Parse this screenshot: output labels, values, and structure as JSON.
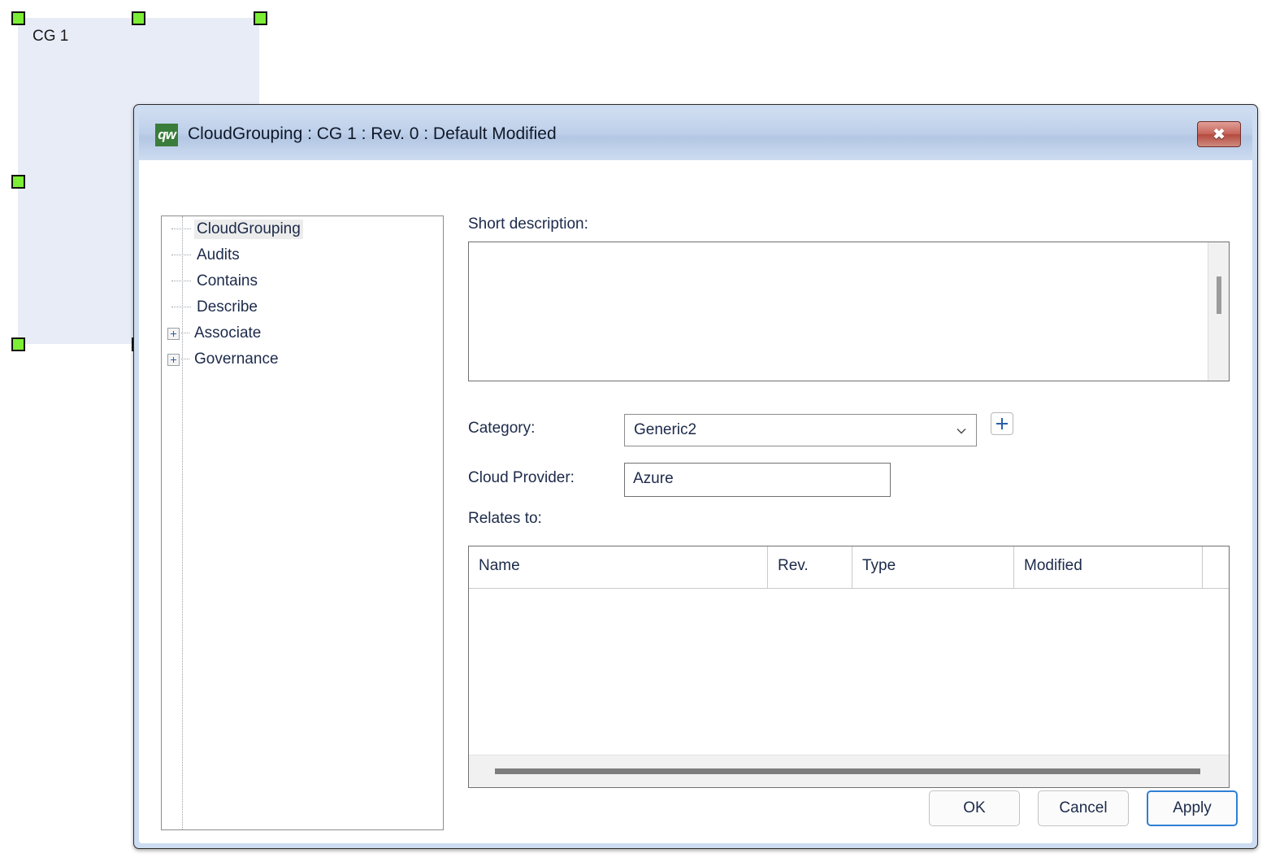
{
  "canvas": {
    "shape": {
      "label": "CG 1",
      "fill_color": "#e8ecf6",
      "handle_color": "#7cee35"
    },
    "handles": [
      {
        "name": "handle-top-left"
      },
      {
        "name": "handle-top-center"
      },
      {
        "name": "handle-top-right"
      },
      {
        "name": "handle-middle-left"
      },
      {
        "name": "handle-bottom-left"
      },
      {
        "name": "handle-bottom-center"
      }
    ]
  },
  "dialog": {
    "title": "CloudGrouping : CG 1 : Rev. 0 : Default Modified",
    "app_icon_text": "qw",
    "close_glyph": "✖",
    "accent_color": "#2f7fd6",
    "titlebar_color": "#bed0ea",
    "tree": {
      "items": [
        {
          "label": "CloudGrouping",
          "expandable": false,
          "selected": true
        },
        {
          "label": "Audits",
          "expandable": false,
          "selected": false
        },
        {
          "label": "Contains",
          "expandable": false,
          "selected": false
        },
        {
          "label": "Describe",
          "expandable": false,
          "selected": false
        },
        {
          "label": "Associate",
          "expandable": true,
          "selected": false
        },
        {
          "label": "Governance",
          "expandable": true,
          "selected": false
        }
      ]
    },
    "form": {
      "short_description_label": "Short description:",
      "short_description_value": "",
      "short_description_placeholder": "",
      "category_label": "Category:",
      "category_value": "Generic2",
      "category_add_label": "+",
      "cloud_provider_label": "Cloud Provider:",
      "cloud_provider_value": "Azure",
      "cloud_provider_placeholder": "",
      "relates_to_label": "Relates to:",
      "relates_to_columns": [
        "Name",
        "Rev.",
        "Type",
        "Modified",
        ""
      ],
      "relates_to_rows": []
    },
    "footer": {
      "ok_label": "OK",
      "cancel_label": "Cancel",
      "apply_label": "Apply"
    }
  }
}
